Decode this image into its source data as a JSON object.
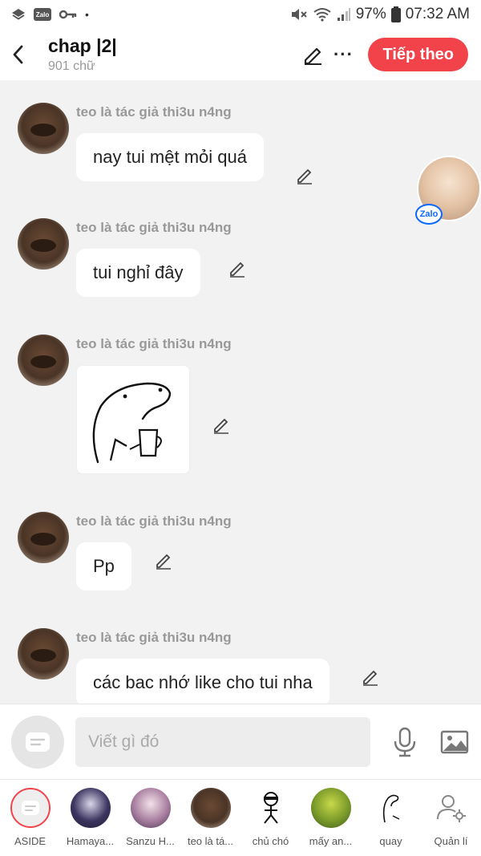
{
  "status_bar": {
    "zalo_badge": "Zalo",
    "battery": "97%",
    "time": "07:32 AM"
  },
  "header": {
    "title": "chap |2|",
    "word_count": "901 chữ",
    "next_button": "Tiếp theo",
    "more_label": "···",
    "accent_color": "#f2434b"
  },
  "messages": [
    {
      "sender": "teo là tác giả thi3u n4ng",
      "text": "nay tui mệt mỏi quá"
    },
    {
      "sender": "teo là tác giả thi3u n4ng",
      "text": "tui nghỉ đây"
    },
    {
      "sender": "teo là tác giả thi3u n4ng",
      "sticker": "doodle-holding-cup"
    },
    {
      "sender": "teo là tác giả thi3u n4ng",
      "text": "Pp"
    },
    {
      "sender": "teo là tác giả thi3u n4ng",
      "text": "các bac nhớ like cho tui nha"
    }
  ],
  "float_chat": {
    "badge": "Zalo"
  },
  "composer": {
    "placeholder": "Viết gì đó"
  },
  "bottom_bar": {
    "items": [
      {
        "label": "ASIDE"
      },
      {
        "label": "Hamaya..."
      },
      {
        "label": "Sanzu H..."
      },
      {
        "label": "teo là tá..."
      },
      {
        "label": "chủ chó"
      },
      {
        "label": "mấy an..."
      },
      {
        "label": "quay"
      },
      {
        "label": "Quản lí"
      }
    ]
  }
}
